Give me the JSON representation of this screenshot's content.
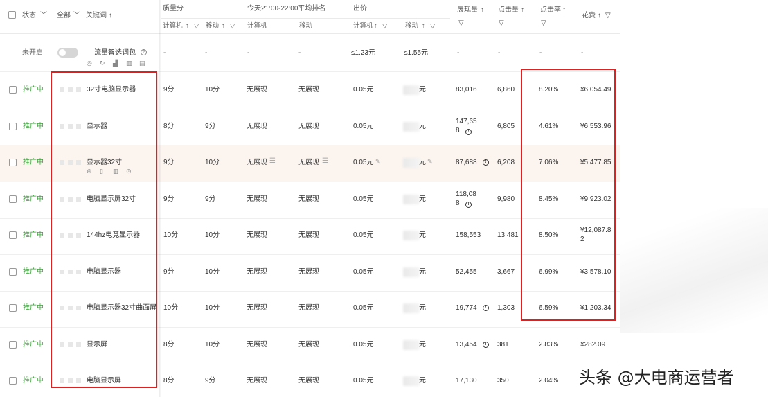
{
  "header": {
    "status": "状态",
    "all": "全部",
    "keyword": "关键词",
    "quality": "质量分",
    "quality_pc": "计算机",
    "quality_mobile": "移动",
    "rank": "今天21:00-22:00平均排名",
    "rank_pc": "计算机",
    "rank_mobile": "移动",
    "bid": "出价",
    "bid_pc": "计算机",
    "bid_mobile": "移动",
    "impressions": "展现量",
    "clicks": "点击量",
    "ctr": "点击率",
    "spend": "花费",
    "sort_icon": "↑",
    "filter_icon": "▽",
    "dropdown_icon": "﹀"
  },
  "package_row": {
    "status": "未开启",
    "name": "流量智选词包",
    "quality_pc": "-",
    "quality_mobile": "-",
    "rank_pc": "-",
    "rank_mobile": "-",
    "bid_pc": "≤1.23元",
    "bid_mobile": "≤1.55元",
    "impressions": "-",
    "clicks": "-",
    "ctr": "-",
    "spend": "-"
  },
  "rows": [
    {
      "status": "推广中",
      "keyword": "32寸电脑显示器",
      "quality_pc": "9分",
      "quality_mobile": "10分",
      "rank_pc": "无展现",
      "rank_mobile": "无展现",
      "bid_pc": "0.05元",
      "bid_mobile": "元",
      "impressions": "83,016",
      "clicks": "6,860",
      "ctr": "8.20%",
      "spend": "¥6,054.49"
    },
    {
      "status": "推广中",
      "keyword": "显示器",
      "quality_pc": "8分",
      "quality_mobile": "9分",
      "rank_pc": "无展现",
      "rank_mobile": "无展现",
      "bid_pc": "0.05元",
      "bid_mobile": "元",
      "impressions": "147,65\n8",
      "clicks": "6,805",
      "ctr": "4.61%",
      "spend": "¥6,553.96"
    },
    {
      "status": "推广中",
      "keyword": "显示器32寸",
      "quality_pc": "9分",
      "quality_mobile": "10分",
      "rank_pc": "无展现",
      "rank_mobile": "无展现",
      "bid_pc": "0.05元",
      "bid_mobile": "元",
      "impressions": "87,688",
      "clicks": "6,208",
      "ctr": "7.06%",
      "spend": "¥5,477.85"
    },
    {
      "status": "推广中",
      "keyword": "电脑显示屏32寸",
      "quality_pc": "9分",
      "quality_mobile": "9分",
      "rank_pc": "无展现",
      "rank_mobile": "无展现",
      "bid_pc": "0.05元",
      "bid_mobile": "元",
      "impressions": "118,08\n8",
      "clicks": "9,980",
      "ctr": "8.45%",
      "spend": "¥9,923.02"
    },
    {
      "status": "推广中",
      "keyword": "144hz电竞显示器",
      "quality_pc": "10分",
      "quality_mobile": "10分",
      "rank_pc": "无展现",
      "rank_mobile": "无展现",
      "bid_pc": "0.05元",
      "bid_mobile": "元",
      "impressions": "158,553",
      "clicks": "13,481",
      "ctr": "8.50%",
      "spend": "¥12,087.8\n2"
    },
    {
      "status": "推广中",
      "keyword": "电脑显示器",
      "quality_pc": "9分",
      "quality_mobile": "10分",
      "rank_pc": "无展现",
      "rank_mobile": "无展现",
      "bid_pc": "0.05元",
      "bid_mobile": "元",
      "impressions": "52,455",
      "clicks": "3,667",
      "ctr": "6.99%",
      "spend": "¥3,578.10"
    },
    {
      "status": "推广中",
      "keyword": "电脑显示器32寸曲面屏",
      "quality_pc": "10分",
      "quality_mobile": "10分",
      "rank_pc": "无展现",
      "rank_mobile": "无展现",
      "bid_pc": "0.05元",
      "bid_mobile": "元",
      "impressions": "19,774",
      "clicks": "1,303",
      "ctr": "6.59%",
      "spend": "¥1,203.34"
    },
    {
      "status": "推广中",
      "keyword": "显示屏",
      "quality_pc": "8分",
      "quality_mobile": "10分",
      "rank_pc": "无展现",
      "rank_mobile": "无展现",
      "bid_pc": "0.05元",
      "bid_mobile": "元",
      "impressions": "13,454",
      "clicks": "381",
      "ctr": "2.83%",
      "spend": "¥282.09"
    },
    {
      "status": "推广中",
      "keyword": "电脑显示屏",
      "quality_pc": "8分",
      "quality_mobile": "9分",
      "rank_pc": "无展现",
      "rank_mobile": "无展现",
      "bid_pc": "0.05元",
      "bid_mobile": "元",
      "impressions": "17,130",
      "clicks": "350",
      "ctr": "2.04%",
      "spend": ""
    }
  ],
  "watermark": "头条 @大电商运营者",
  "colors": {
    "status_green": "#3aa238",
    "highlight_red": "#e02020",
    "row_highlight": "#fbf4ef"
  }
}
